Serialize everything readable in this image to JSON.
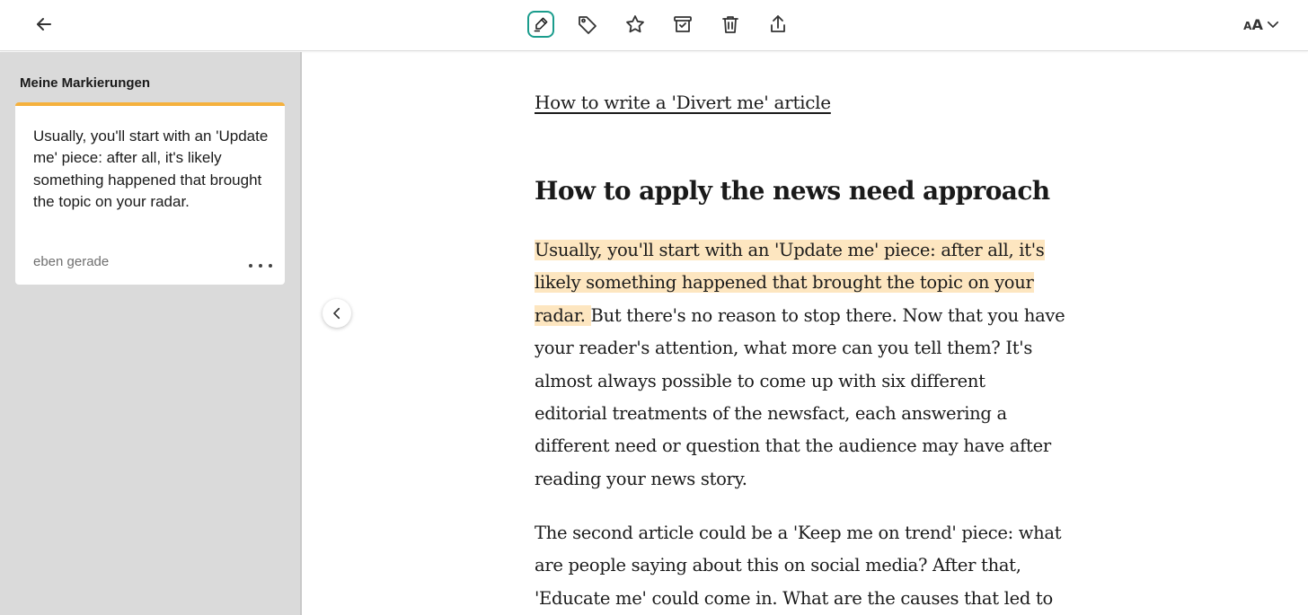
{
  "toolbar": {
    "icons": [
      "arrow-left-icon",
      "highlighter-icon",
      "tag-icon",
      "star-icon",
      "archive-icon",
      "trash-icon",
      "share-icon",
      "font-size-icon",
      "chevron-down-icon"
    ],
    "font_label_small": "A",
    "font_label_big": "A",
    "accent_color": "#1a9c8c"
  },
  "sidebar": {
    "title": "Meine Markierungen",
    "highlights": [
      {
        "text": "Usually, you'll start with an 'Update me' piece: after all, it's likely something happened that brought the topic on your radar.",
        "time": "eben gerade",
        "color": "#f5b13d"
      }
    ]
  },
  "article": {
    "link_text": "How to write a 'Divert me' article",
    "heading": "How to apply the news need approach",
    "para1_highlighted": "Usually, you'll start with an 'Update me' piece: after all, it's likely something happened that brought the topic on your radar. ",
    "para1_lines": [
      "Usually, you'll start with an 'Update me' piece: after all, it's",
      "likely something happened that brought the topic on your",
      "radar. ",
      "But there's no reason to stop there. Now that you have",
      "your reader's attention, what more can you tell them? It's",
      "almost always possible to come up with six different",
      "editorial treatments of the newsfact, each answering a",
      "different need or question that the audience may have after",
      "reading your news story."
    ],
    "para2_lines": [
      "The second article could be a 'Keep me on trend' piece: what",
      "are people saying about this on social media? After that,",
      "'Educate me' could come in. What are the causes that led to"
    ],
    "highlight_color": "#fde6c0"
  }
}
